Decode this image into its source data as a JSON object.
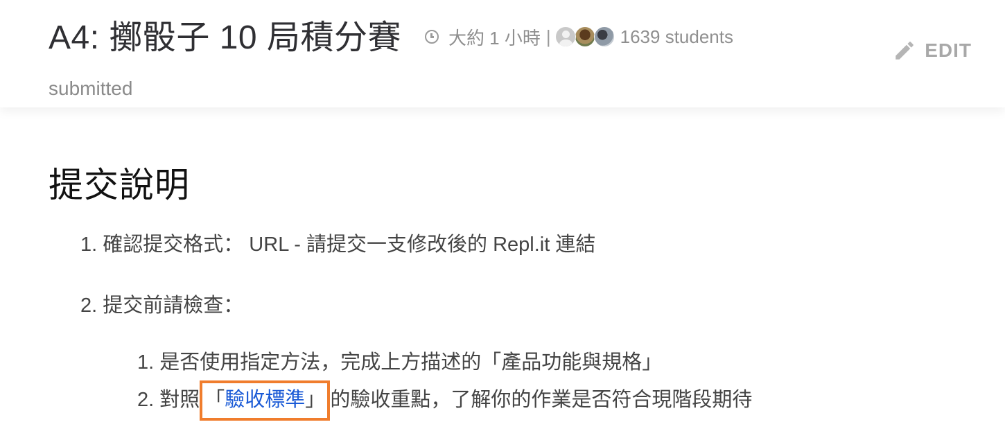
{
  "header": {
    "title": "A4: 擲骰子 10 局積分賽",
    "duration": "大約 1 小時",
    "separator": "|",
    "students": "1639 students",
    "edit_label": "EDIT",
    "status": "submitted"
  },
  "section": {
    "title": "提交說明",
    "items": [
      {
        "number": "1.",
        "text": "確認提交格式： URL - 請提交一支修改後的 Repl.it 連結"
      },
      {
        "number": "2.",
        "text": "提交前請檢查："
      }
    ],
    "subitems": [
      {
        "number": "1.",
        "text": "是否使用指定方法，完成上方描述的「產品功能與規格」"
      },
      {
        "number": "2.",
        "prefix": "對照",
        "open_bracket": "「",
        "link_text": "驗收標準",
        "close_bracket": "」",
        "suffix": "的驗收重點，了解你的作業是否符合現階段期待"
      }
    ]
  },
  "colors": {
    "link": "#1a5ad6",
    "highlight_box": "#f07d2d"
  },
  "icons": [
    "clock-icon",
    "pencil-icon",
    "avatar"
  ]
}
